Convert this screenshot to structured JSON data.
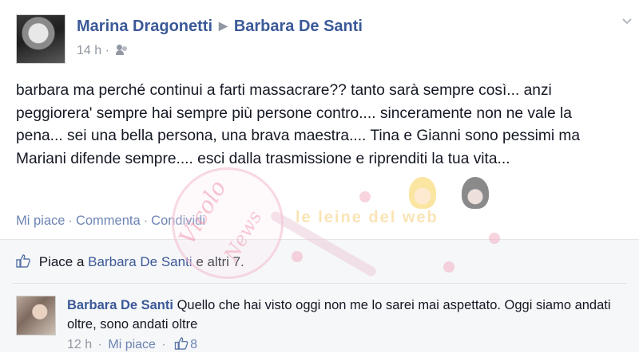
{
  "post": {
    "author": "Marina Dragonetti",
    "target": "Barbara De Santi",
    "time": "14 h",
    "audience_icon": "friends-icon",
    "text": "barbara ma perché continui a farti massacrare?? tanto sarà sempre così... anzi peggiorera' sempre hai sempre più persone contro.... sinceramente non ne vale la pena... sei una bella persona, una brava maestra.... Tina e Gianni sono pessimi ma Mariani difende sempre.... esci dalla trasmissione e riprenditi la tua vita..."
  },
  "actions": {
    "like": "Mi piace",
    "comment": "Commenta",
    "share": "Condividi"
  },
  "likes": {
    "prefix": "Piace a",
    "name": "Barbara De Santi",
    "suffix": "e altri 7."
  },
  "comment": {
    "author": "Barbara De Santi",
    "text": "Quello che hai visto oggi non me lo sarei mai aspettato. Oggi siamo andati oltre, sono andati oltre",
    "time": "12 h",
    "like": "Mi piace",
    "like_count": "8"
  },
  "watermark": {
    "brand": "le leine del web",
    "circle_text": "Vicolo",
    "circle_text2": "News"
  },
  "colors": {
    "link": "#3b5998",
    "secondary": "#9197a3",
    "action": "#6d84b4",
    "text": "#141823"
  }
}
